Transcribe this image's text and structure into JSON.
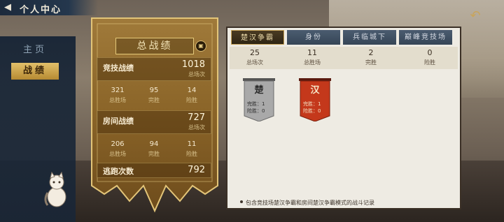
{
  "header": {
    "title": "个人中心",
    "back_icon": "back-arrow-icon",
    "return_icon": "return-arrow-icon"
  },
  "nav": {
    "items": [
      {
        "label": "主页",
        "active": false
      },
      {
        "label": "战绩",
        "active": true
      }
    ]
  },
  "banner": {
    "title": "总战绩",
    "competitive": {
      "label": "竞技战绩",
      "total": "1018",
      "total_label": "总场次",
      "wins": "321",
      "wins_label": "总胜场",
      "perfect": "95",
      "perfect_label": "完胜",
      "narrow": "14",
      "narrow_label": "险胜"
    },
    "room": {
      "label": "房间战绩",
      "total": "727",
      "total_label": "总场次",
      "wins": "206",
      "wins_label": "总胜场",
      "perfect": "94",
      "perfect_label": "完胜",
      "narrow": "11",
      "narrow_label": "险胜"
    },
    "escape": {
      "label": "逃跑次数",
      "value": "792"
    }
  },
  "tabs": [
    {
      "label": "楚汉争霸",
      "active": true
    },
    {
      "label": "身份",
      "active": false
    },
    {
      "label": "兵临城下",
      "active": false
    },
    {
      "label": "巅峰竞技场",
      "active": false
    }
  ],
  "summary": [
    {
      "value": "25",
      "label": "总场次"
    },
    {
      "value": "11",
      "label": "总胜场"
    },
    {
      "value": "2",
      "label": "完胜"
    },
    {
      "value": "0",
      "label": "险胜"
    }
  ],
  "cards": [
    {
      "char": "楚",
      "line1": "完胜：1",
      "line2": "险胜：0",
      "color": "#9a9a9a"
    },
    {
      "char": "汉",
      "line1": "完胜：1",
      "line2": "险胜：0",
      "color": "#c4381b"
    }
  ],
  "footnote": "包含竞技场楚汉争霸和房间楚汉争霸模式的战斗记录",
  "colors": {
    "gold": "#d7b467",
    "nav_bg": "#16243a",
    "panel_bg": "#eeebe3"
  }
}
